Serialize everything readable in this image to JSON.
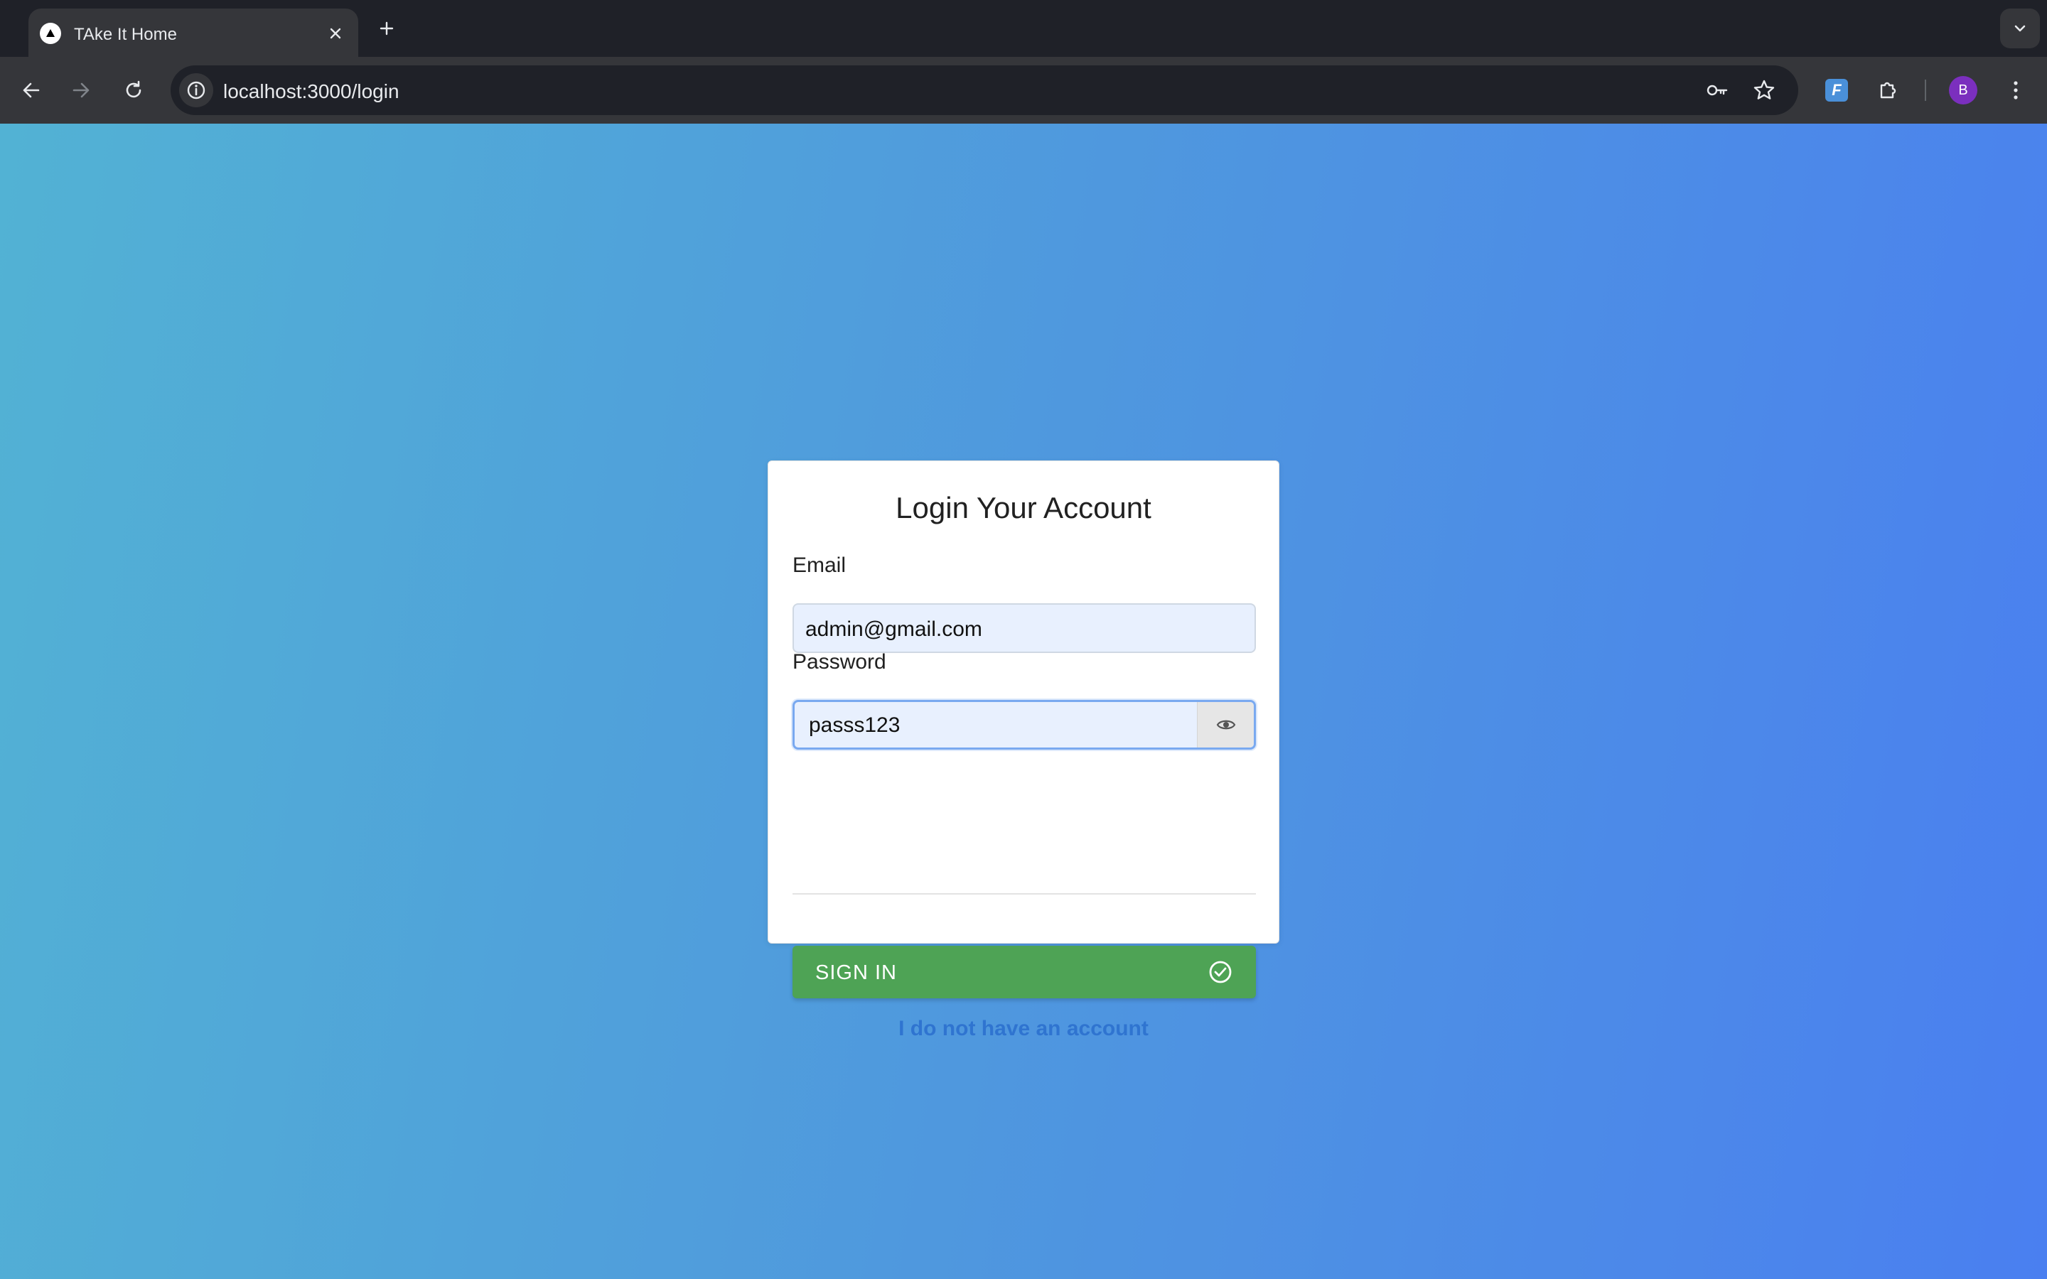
{
  "browser": {
    "tab_title": "TAke It Home",
    "url": "localhost:3000/login",
    "profile_initial": "B",
    "extension_label": "F"
  },
  "login": {
    "title": "Login Your Account",
    "email_label": "Email",
    "email_value": "admin@gmail.com",
    "password_label": "Password",
    "password_value": "passs123",
    "signin_label": "SIGN IN",
    "signup_link": "I do not have an account"
  },
  "colors": {
    "signin_button": "#4ea355",
    "link": "#2f74d0",
    "gradient_start": "#52b2d4",
    "gradient_end": "#4a7ff0"
  },
  "icons": [
    "triangle-favicon-icon",
    "close-icon",
    "plus-icon",
    "chevron-down-icon",
    "back-arrow-icon",
    "forward-arrow-icon",
    "reload-icon",
    "info-icon",
    "key-icon",
    "star-icon",
    "puzzle-icon",
    "more-vert-icon",
    "eye-icon",
    "check-circle-icon"
  ]
}
